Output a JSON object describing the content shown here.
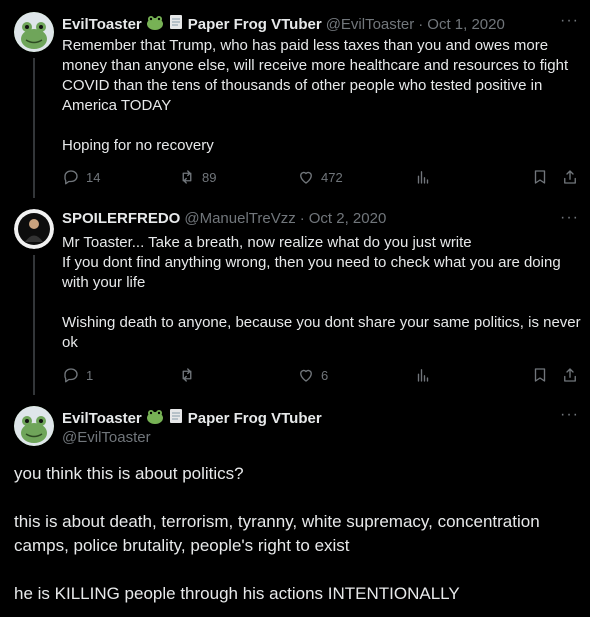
{
  "tweets": [
    {
      "display_name": "EvilToaster",
      "name_suffix": "Paper Frog VTuber",
      "handle": "@EvilToaster",
      "date": "Oct 1, 2020",
      "text": "Remember that Trump, who has paid less taxes than you and owes more money than anyone else, will receive more healthcare and resources to fight COVID than the tens of thousands of other people who tested positive in America TODAY\n\nHoping for no recovery",
      "replies": "14",
      "retweets": "89",
      "likes": "472"
    },
    {
      "display_name": "SPOILERFREDO",
      "handle": "@ManuelTreVzz",
      "date": "Oct 2, 2020",
      "text": "Mr Toaster... Take a breath, now realize what do you just write\nIf you dont find anything wrong, then you need to check what you are doing with your life\n\nWishing death to anyone, because you dont share your same politics, is never ok",
      "replies": "1",
      "retweets": "",
      "likes": "6"
    }
  ],
  "main_tweet": {
    "display_name": "EvilToaster",
    "name_suffix": "Paper Frog VTuber",
    "handle": "@EvilToaster",
    "text": "you think this is about politics?\n\nthis is about death, terrorism, tyranny, white supremacy, concentration camps, police brutality, people's right to exist\n\nhe is KILLING people through his actions INTENTIONALLY"
  },
  "separator": "·",
  "more_label": "···",
  "icons": {
    "reply": "reply-icon",
    "retweet": "retweet-icon",
    "like": "heart-icon",
    "views": "views-icon",
    "bookmark": "bookmark-icon",
    "share": "share-icon",
    "frog": "frog-emoji",
    "scroll": "scroll-emoji"
  }
}
